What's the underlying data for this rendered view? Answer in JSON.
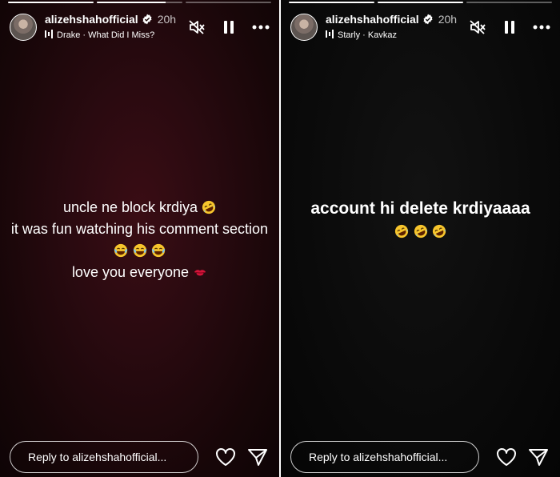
{
  "stories": [
    {
      "progress": [
        1,
        0.8,
        0
      ],
      "username": "alizehshahofficial",
      "time": "20h",
      "music": "Drake · What Did I Miss?",
      "caption_lines": [
        "uncle ne block krdiya",
        "it was fun watching his comment section",
        "",
        "love you everyone"
      ],
      "emojis": [
        "rolling-on-floor-laughing",
        "tears-of-joy",
        "kiss-mark"
      ],
      "reply_placeholder": "Reply to alizehshahofficial..."
    },
    {
      "progress": [
        1,
        1,
        0
      ],
      "username": "alizehshahofficial",
      "time": "20h",
      "music": "Starly · Kavkaz",
      "caption_lines": [
        "account hi delete krdiyaaaa"
      ],
      "emojis": [
        "rolling-on-floor-laughing"
      ],
      "reply_placeholder": "Reply to alizehshahofficial..."
    }
  ],
  "colors": {
    "verified": "#ffffff",
    "tear_emoji": "#f7c52c",
    "kiss": "#d4143a"
  },
  "icons": [
    "verified-icon",
    "music-bars-icon",
    "mute-icon",
    "pause-icon",
    "more-icon",
    "heart-icon",
    "send-icon"
  ]
}
